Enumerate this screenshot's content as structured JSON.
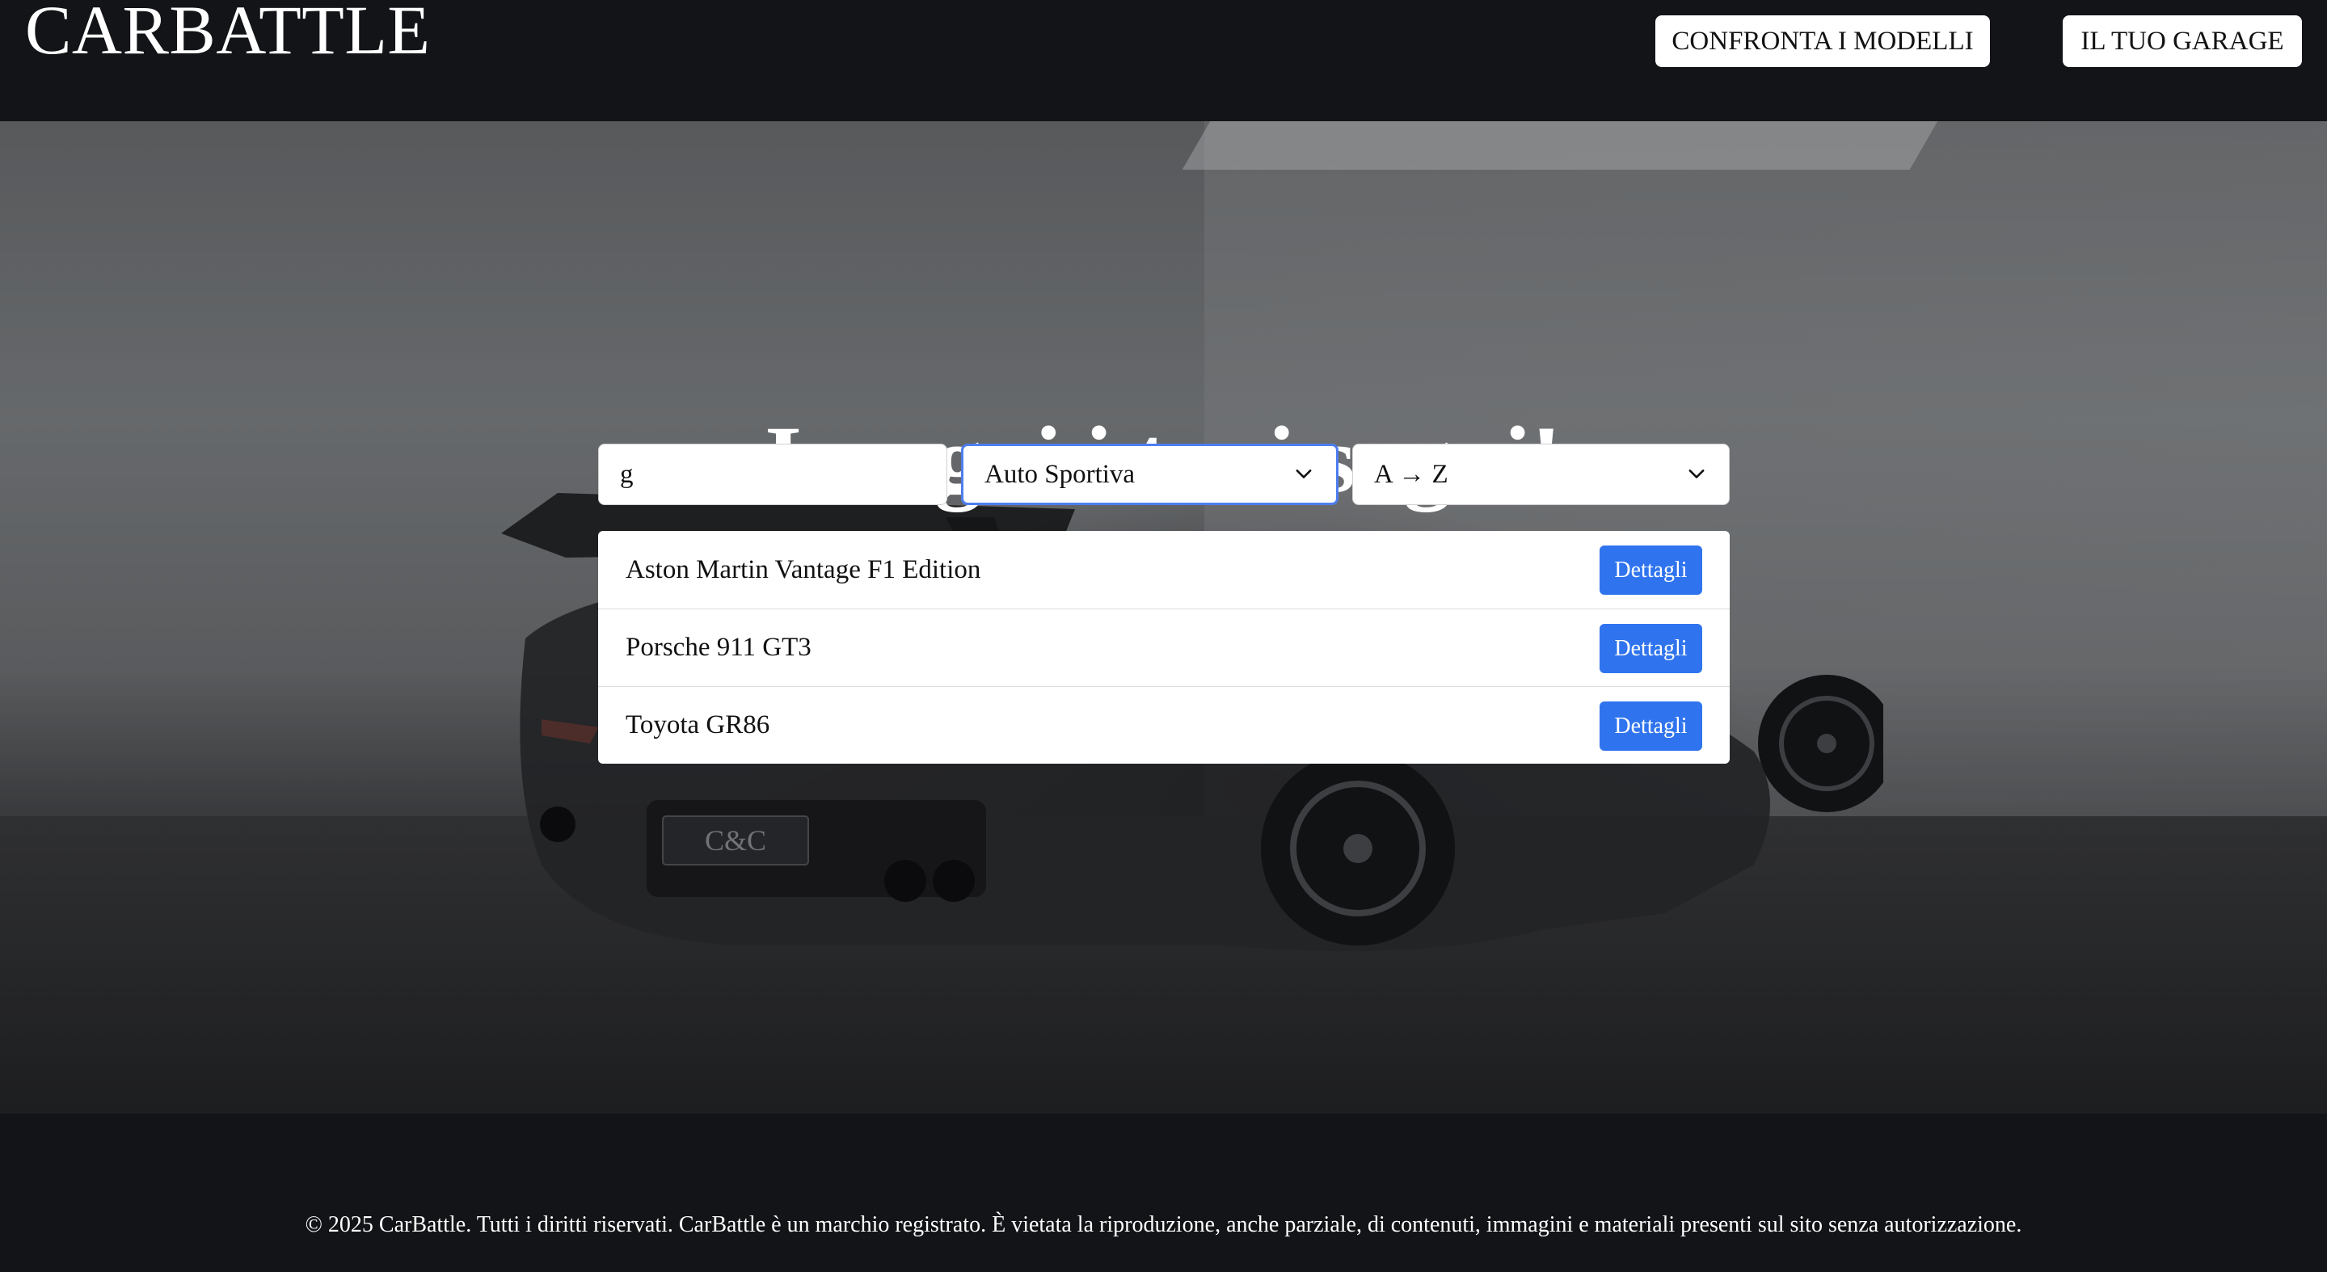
{
  "header": {
    "logo": "CARBATTLE",
    "nav": {
      "compare_label": "CONFRONTA I MODELLI",
      "garage_label": "IL TUO GARAGE"
    }
  },
  "hero": {
    "title": "Insegui i tuoi sogni!",
    "plate_text": "C&C"
  },
  "filters": {
    "search_value": "g",
    "type_selected": "Auto Sportiva",
    "sort_selected": "A → Z"
  },
  "results": {
    "items": [
      {
        "name": "Aston Martin Vantage F1 Edition",
        "button": "Dettagli"
      },
      {
        "name": "Porsche 911 GT3",
        "button": "Dettagli"
      },
      {
        "name": "Toyota GR86",
        "button": "Dettagli"
      }
    ]
  },
  "footer": {
    "text": "© 2025 CarBattle. Tutti i diritti riservati. CarBattle è un marchio registrato. È vietata la riproduzione, anche parziale, di contenuti, immagini e materiali presenti sul sito senza autorizzazione."
  },
  "colors": {
    "header_bg": "#121417",
    "accent_button": "#2f74ee",
    "focus_border": "#4d7ef0"
  },
  "icons": [
    "chevron-down-icon"
  ]
}
